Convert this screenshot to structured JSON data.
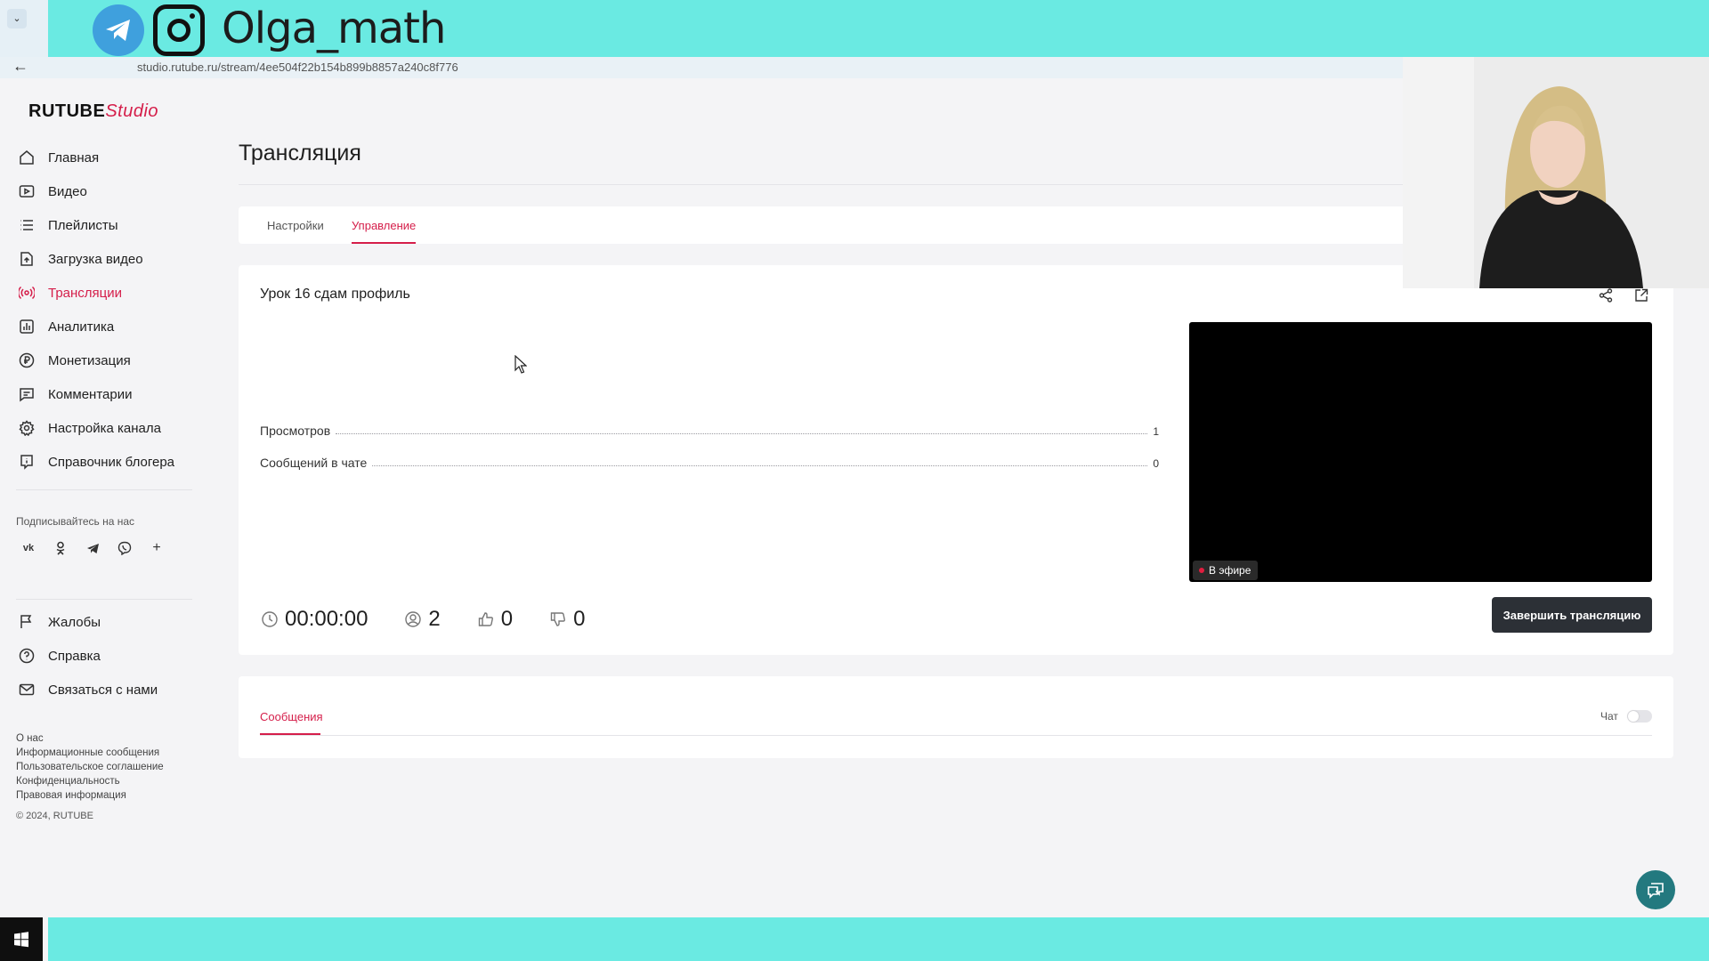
{
  "overlay": {
    "handle": "Olga_math"
  },
  "browser": {
    "url_fragment": "studio.rutube.ru/stream/4ee504f22b154b899b8857a240c8f776"
  },
  "sidebar": {
    "logo": {
      "brand": "RUTUBE",
      "product": "Studio"
    },
    "nav": [
      {
        "label": "Главная",
        "icon": "home-icon"
      },
      {
        "label": "Видео",
        "icon": "video-icon"
      },
      {
        "label": "Плейлисты",
        "icon": "list-icon"
      },
      {
        "label": "Загрузка видео",
        "icon": "upload-icon"
      },
      {
        "label": "Трансляции",
        "icon": "broadcast-icon"
      },
      {
        "label": "Аналитика",
        "icon": "analytics-icon"
      },
      {
        "label": "Монетизация",
        "icon": "ruble-icon"
      },
      {
        "label": "Комментарии",
        "icon": "comment-icon"
      },
      {
        "label": "Настройка канала",
        "icon": "gear-icon"
      },
      {
        "label": "Справочник блогера",
        "icon": "info-icon"
      }
    ],
    "subscribe_label": "Подписывайтесь на нас",
    "socials": [
      "vk-icon",
      "ok-icon",
      "telegram-icon",
      "viber-icon",
      "plus-icon"
    ],
    "nav_secondary": [
      {
        "label": "Жалобы",
        "icon": "flag-icon"
      },
      {
        "label": "Справка",
        "icon": "help-icon"
      },
      {
        "label": "Связаться с нами",
        "icon": "mail-icon"
      }
    ],
    "footer_links": [
      "О нас",
      "Информационные сообщения",
      "Пользовательское соглашение",
      "Конфиденциальность",
      "Правовая информация"
    ],
    "copyright": "© 2024, RUTUBE"
  },
  "main": {
    "page_title": "Трансляция",
    "tabs": [
      {
        "label": "Настройки"
      },
      {
        "label": "Управление"
      }
    ],
    "stream": {
      "title": "Урок 16 сдам профиль",
      "stats": [
        {
          "label": "Просмотров",
          "value": "1"
        },
        {
          "label": "Сообщений в чате",
          "value": "0"
        }
      ],
      "live_badge": "В эфире",
      "metrics": {
        "duration": "00:00:00",
        "viewers": "2",
        "likes": "0",
        "dislikes": "0"
      },
      "end_button": "Завершить трансляцию"
    },
    "chat": {
      "tab_label": "Сообщения",
      "toggle_label": "Чат"
    }
  },
  "colors": {
    "accent": "#d51e4a",
    "overlay": "#6aeae2",
    "button_dark": "#2c3036",
    "fab": "#23797f"
  }
}
